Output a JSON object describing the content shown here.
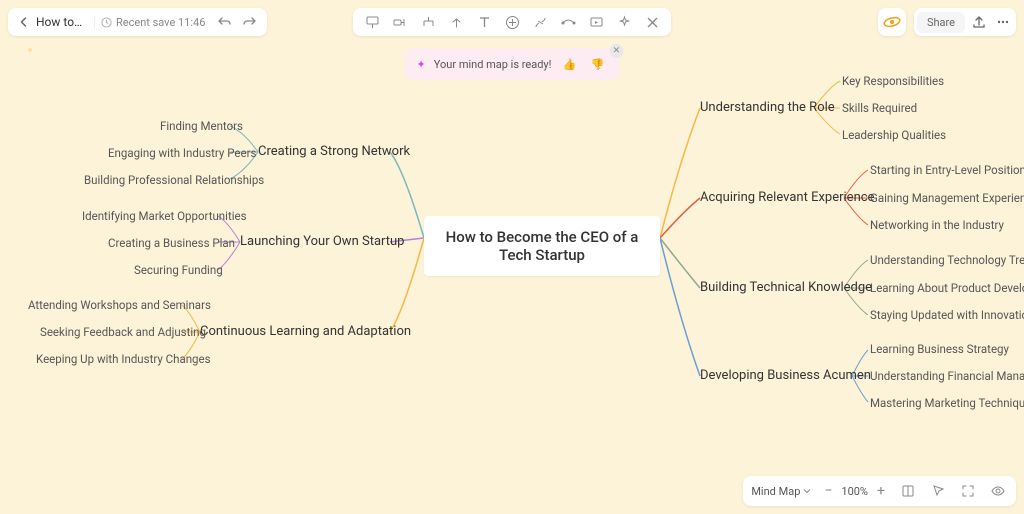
{
  "header": {
    "title": "How to ...",
    "save_label": "Recent save 11:46"
  },
  "notification": {
    "text": "Your mind map is ready!"
  },
  "rightbar": {
    "share_label": "Share"
  },
  "bottombar": {
    "view_label": "Mind Map",
    "zoom": "100%"
  },
  "mindmap": {
    "center": "How to Become the CEO of a Tech Startup",
    "right": [
      {
        "label": "Understanding the Role",
        "color": "#f5b941",
        "children": [
          "Key Responsibilities",
          "Skills Required",
          "Leadership Qualities"
        ]
      },
      {
        "label": "Acquiring Relevant Experience",
        "color": "#e85d3d",
        "children": [
          "Starting in Entry-Level Positions",
          "Gaining Management Experience",
          "Networking in the Industry"
        ]
      },
      {
        "label": "Building Technical Knowledge",
        "color": "#8fa88f",
        "children": [
          "Understanding Technology Trends",
          "Learning About Product Development",
          "Staying Updated with Innovations"
        ]
      },
      {
        "label": "Developing Business Acumen",
        "color": "#6b9fd4",
        "children": [
          "Learning Business Strategy",
          "Understanding Financial Management",
          "Mastering Marketing Techniques"
        ]
      }
    ],
    "left": [
      {
        "label": "Creating a Strong Network",
        "color": "#7fb8b8",
        "children": [
          "Finding Mentors",
          "Engaging with Industry Peers",
          "Building Professional Relationships"
        ]
      },
      {
        "label": "Launching Your Own Startup",
        "color": "#b87fd4",
        "children": [
          "Identifying Market Opportunities",
          "Creating a Business Plan",
          "Securing Funding"
        ]
      },
      {
        "label": "Continuous Learning and Adaptation",
        "color": "#f5b941",
        "children": [
          "Attending Workshops and Seminars",
          "Seeking Feedback and Adjusting",
          "Keeping Up with Industry Changes"
        ]
      }
    ]
  }
}
